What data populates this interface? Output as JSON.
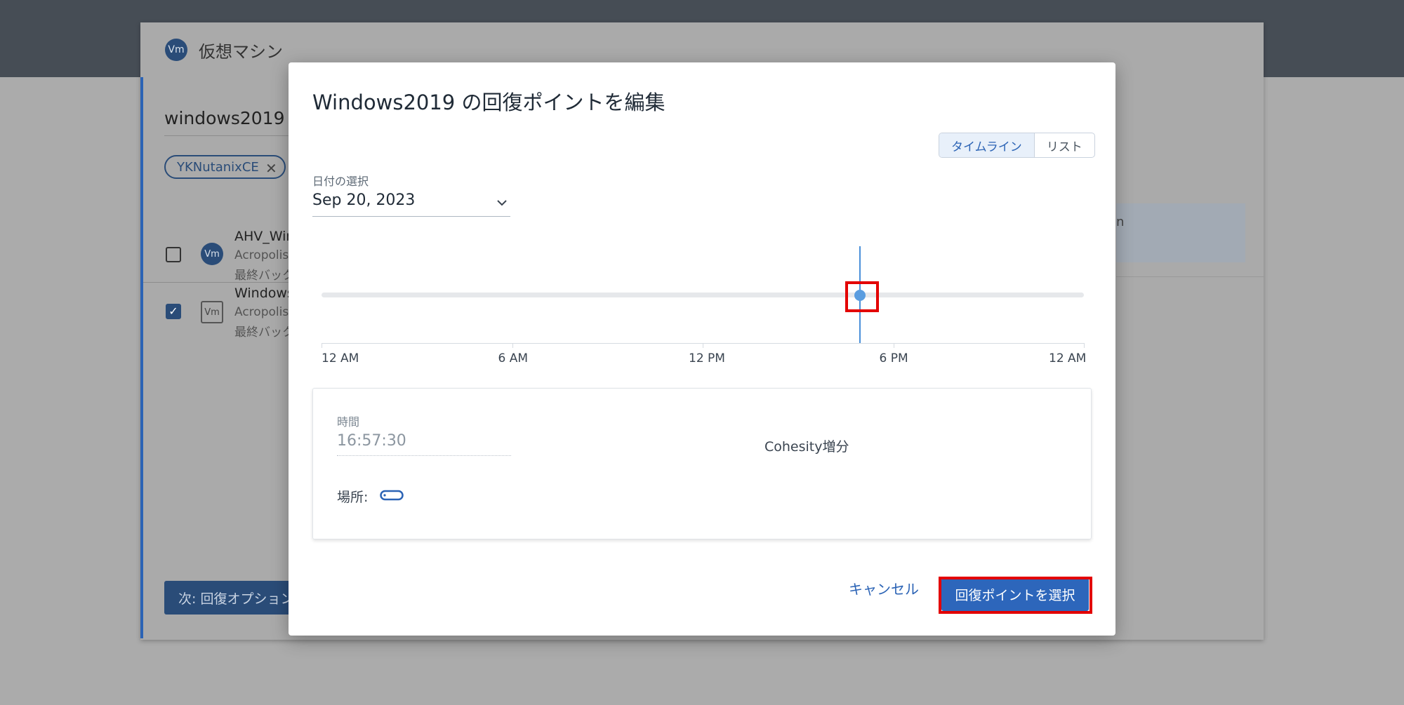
{
  "background": {
    "page_title": "仮想マシン",
    "vm_badge": "Vm",
    "selected_vm": "windows2019",
    "filter_chip": "YKNutanixCE",
    "filter_chip_close": "✕",
    "rows": [
      {
        "checked": false,
        "icon": "Vm",
        "name": "AHV_Win",
        "sub1": "Acropolis",
        "sub2": "最終バック"
      },
      {
        "checked": true,
        "icon": "Vm",
        "name": "Windows",
        "sub1": "Acropolis",
        "sub2": "最終バック"
      }
    ],
    "next_button": "次: 回復オプション",
    "right_panel_text": "n"
  },
  "modal": {
    "title": "Windows2019 の回復ポイントを編集",
    "view_toggle": {
      "timeline": "タイムライン",
      "list": "リスト",
      "active": "timeline"
    },
    "date_label": "日付の選択",
    "date_value": "Sep 20, 2023",
    "timeline": {
      "axis_labels": [
        "12 AM",
        "6 AM",
        "12 PM",
        "6 PM",
        "12 AM"
      ],
      "domain_hours": [
        0,
        24
      ],
      "recovery_points_hours": [
        16.96
      ],
      "selected_hour": 16.96
    },
    "details": {
      "time_label": "時間",
      "time_value": "16:57:30",
      "type": "Cohesity増分",
      "location_label": "場所:",
      "location_icon": "pill-location-icon"
    },
    "cancel_button": "キャンセル",
    "select_button": "回復ポイントを選択"
  },
  "colors": {
    "accent": "#2d66bb",
    "highlight": "#e30000",
    "point": "#5a9de0"
  }
}
